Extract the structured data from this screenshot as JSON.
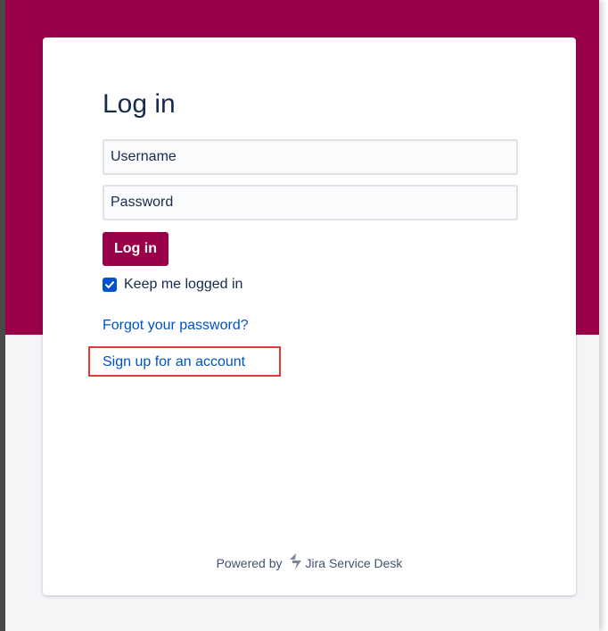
{
  "colors": {
    "brand": "#990048",
    "page_background": "#f4f5f7",
    "link": "#0052cc",
    "highlight": "#e53935",
    "jira_icon": "#7a869a"
  },
  "login": {
    "title": "Log in",
    "username_placeholder": "Username",
    "password_placeholder": "Password",
    "submit_label": "Log in",
    "keep_logged_in_label": "Keep me logged in",
    "keep_logged_in_checked": true,
    "forgot_password_link": "Forgot your password?",
    "signup_link": "Sign up for an account"
  },
  "footer": {
    "powered_by": "Powered by",
    "product_icon": "jira-service-desk-icon",
    "product_name": "Jira Service Desk"
  }
}
